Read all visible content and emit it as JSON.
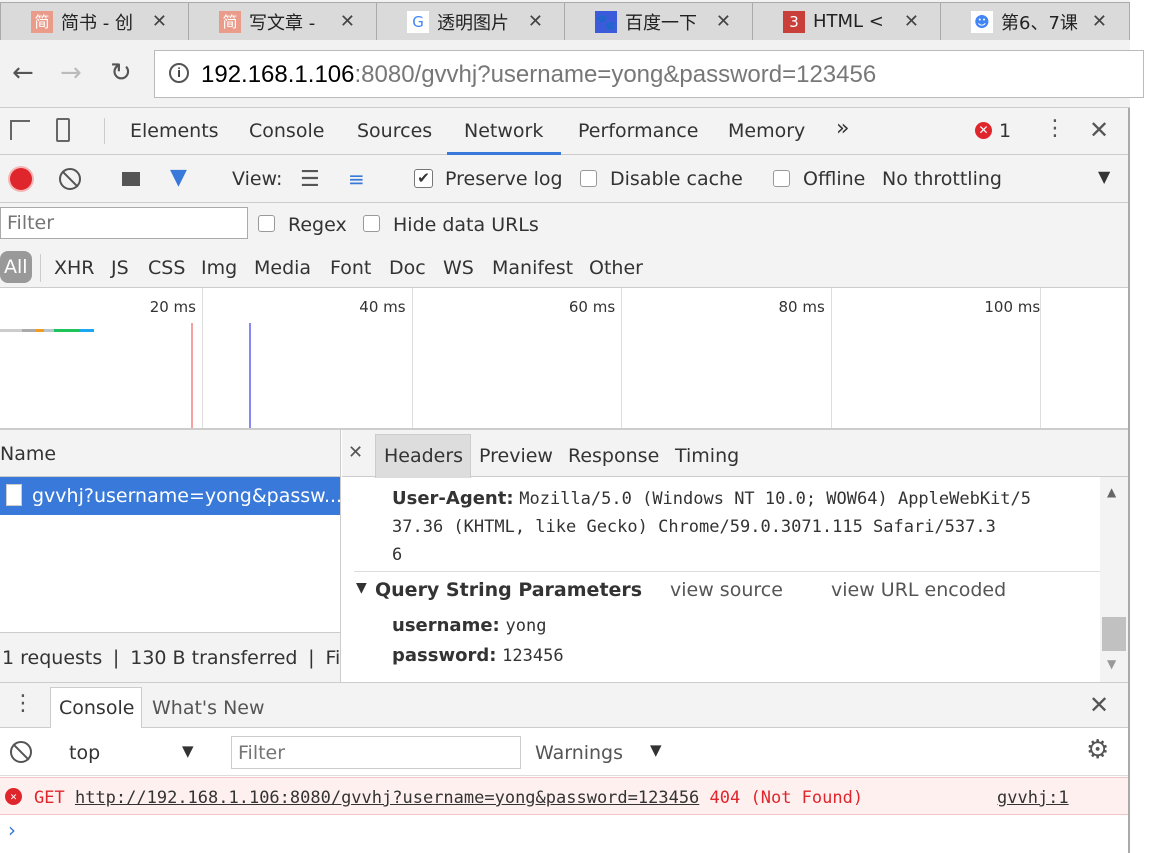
{
  "browser_tabs": [
    {
      "title": "简书 - 创",
      "icon": "jianshu-icon",
      "color": "#ea9b8a",
      "glyph": "简"
    },
    {
      "title": "写文章 -",
      "icon": "jianshu-icon",
      "color": "#ea9b8a",
      "glyph": "简"
    },
    {
      "title": "透明图片",
      "icon": "google-icon",
      "color": "#ffffff",
      "glyph": "G"
    },
    {
      "title": "百度一下",
      "icon": "baidu-paw-icon",
      "color": "#3b5bdb",
      "glyph": "🐾"
    },
    {
      "title": "HTML <",
      "icon": "html-icon",
      "color": "#c9403a",
      "glyph": "3"
    },
    {
      "title": "第6、7课",
      "icon": "ghost-icon",
      "color": "#ffffff",
      "glyph": "☻"
    }
  ],
  "address": {
    "host": "192.168.1.106",
    "rest": ":8080/gvvhj?username=yong&password=123456"
  },
  "devtools": {
    "tabs": [
      "Elements",
      "Console",
      "Sources",
      "Network",
      "Performance",
      "Memory"
    ],
    "active": "Network",
    "more": "»",
    "error_count": "1"
  },
  "network_toolbar": {
    "view_label": "View:",
    "preserve_log": "Preserve log",
    "preserve_log_checked": true,
    "disable_cache": "Disable cache",
    "offline": "Offline",
    "throttling": "No throttling"
  },
  "filter": {
    "placeholder": "Filter",
    "regex": "Regex",
    "hide_data_urls": "Hide data URLs"
  },
  "types": [
    "All",
    "XHR",
    "JS",
    "CSS",
    "Img",
    "Media",
    "Font",
    "Doc",
    "WS",
    "Manifest",
    "Other"
  ],
  "timeline": {
    "ticks": [
      "20 ms",
      "40 ms",
      "60 ms",
      "80 ms",
      "100 ms"
    ]
  },
  "requests": {
    "header": "Name",
    "items": [
      "gvvhj?username=yong&passw..."
    ],
    "status": "1 requests  ❘  130 B transferred  ❘  Fi..."
  },
  "detail": {
    "tabs": [
      "Headers",
      "Preview",
      "Response",
      "Timing"
    ],
    "active": "Headers",
    "user_agent_key": "User-Agent:",
    "user_agent_lines": [
      "Mozilla/5.0 (Windows NT 10.0; WOW64) AppleWebKit/5",
      "37.36 (KHTML, like Gecko) Chrome/59.0.3071.115 Safari/537.3",
      "6"
    ],
    "qs_title": "Query String Parameters",
    "view_source": "view source",
    "view_url_encoded": "view URL encoded",
    "params": [
      {
        "k": "username:",
        "v": "yong"
      },
      {
        "k": "password:",
        "v": "123456"
      }
    ]
  },
  "drawer": {
    "tabs": [
      "Console",
      "What's New"
    ],
    "context": "top",
    "filter_placeholder": "Filter",
    "level": "Warnings"
  },
  "console": {
    "method": "GET",
    "url": "http://192.168.1.106:8080/gvvhj?username=yong&password=123456",
    "status": "404 (Not Found)",
    "source": "gvvhj:1"
  }
}
